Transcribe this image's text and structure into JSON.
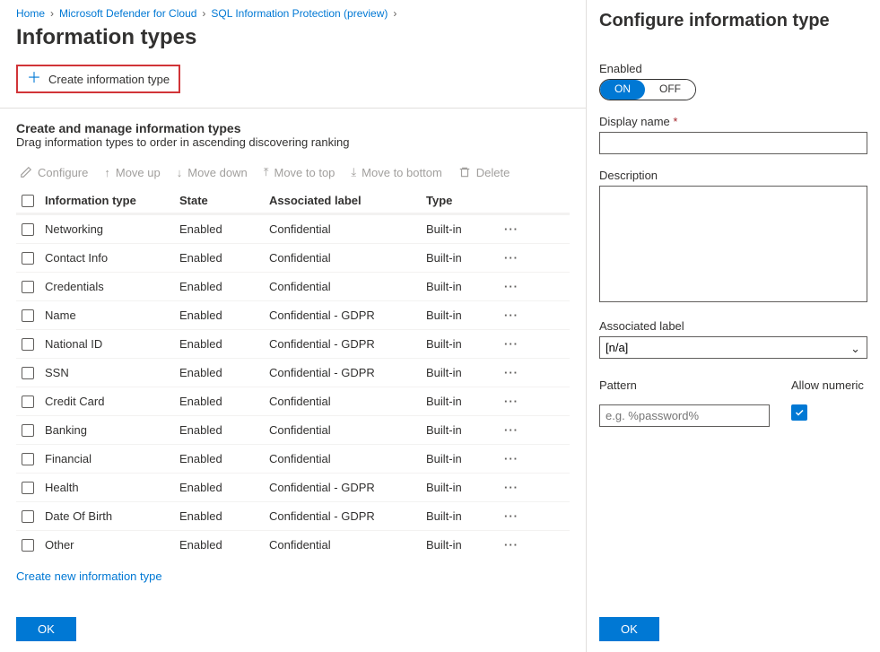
{
  "breadcrumb": {
    "items": [
      "Home",
      "Microsoft Defender for Cloud",
      "SQL Information Protection (preview)"
    ]
  },
  "page_title": "Information types",
  "create_button": "Create information type",
  "section": {
    "heading": "Create and manage information types",
    "desc": "Drag information types to order in ascending discovering ranking"
  },
  "toolbar": {
    "configure": "Configure",
    "moveup": "Move up",
    "movedown": "Move down",
    "movetop": "Move to top",
    "movebottom": "Move to bottom",
    "delete": "Delete"
  },
  "columns": {
    "c1": "Information type",
    "c2": "State",
    "c3": "Associated label",
    "c4": "Type"
  },
  "rows": [
    {
      "name": "Networking",
      "state": "Enabled",
      "label": "Confidential",
      "type": "Built-in"
    },
    {
      "name": "Contact Info",
      "state": "Enabled",
      "label": "Confidential",
      "type": "Built-in"
    },
    {
      "name": "Credentials",
      "state": "Enabled",
      "label": "Confidential",
      "type": "Built-in"
    },
    {
      "name": "Name",
      "state": "Enabled",
      "label": "Confidential - GDPR",
      "type": "Built-in"
    },
    {
      "name": "National ID",
      "state": "Enabled",
      "label": "Confidential - GDPR",
      "type": "Built-in"
    },
    {
      "name": "SSN",
      "state": "Enabled",
      "label": "Confidential - GDPR",
      "type": "Built-in"
    },
    {
      "name": "Credit Card",
      "state": "Enabled",
      "label": "Confidential",
      "type": "Built-in"
    },
    {
      "name": "Banking",
      "state": "Enabled",
      "label": "Confidential",
      "type": "Built-in"
    },
    {
      "name": "Financial",
      "state": "Enabled",
      "label": "Confidential",
      "type": "Built-in"
    },
    {
      "name": "Health",
      "state": "Enabled",
      "label": "Confidential - GDPR",
      "type": "Built-in"
    },
    {
      "name": "Date Of Birth",
      "state": "Enabled",
      "label": "Confidential - GDPR",
      "type": "Built-in"
    },
    {
      "name": "Other",
      "state": "Enabled",
      "label": "Confidential",
      "type": "Built-in"
    }
  ],
  "create_link": "Create new information type",
  "ok": "OK",
  "panel": {
    "title": "Configure information type",
    "enabled_label": "Enabled",
    "on": "ON",
    "off": "OFF",
    "display_name": "Display name",
    "description": "Description",
    "assoc_label": "Associated label",
    "assoc_value": "[n/a]",
    "pattern": "Pattern",
    "allow_numeric": "Allow numeric",
    "pattern_placeholder": "e.g. %password%",
    "ok": "OK"
  }
}
